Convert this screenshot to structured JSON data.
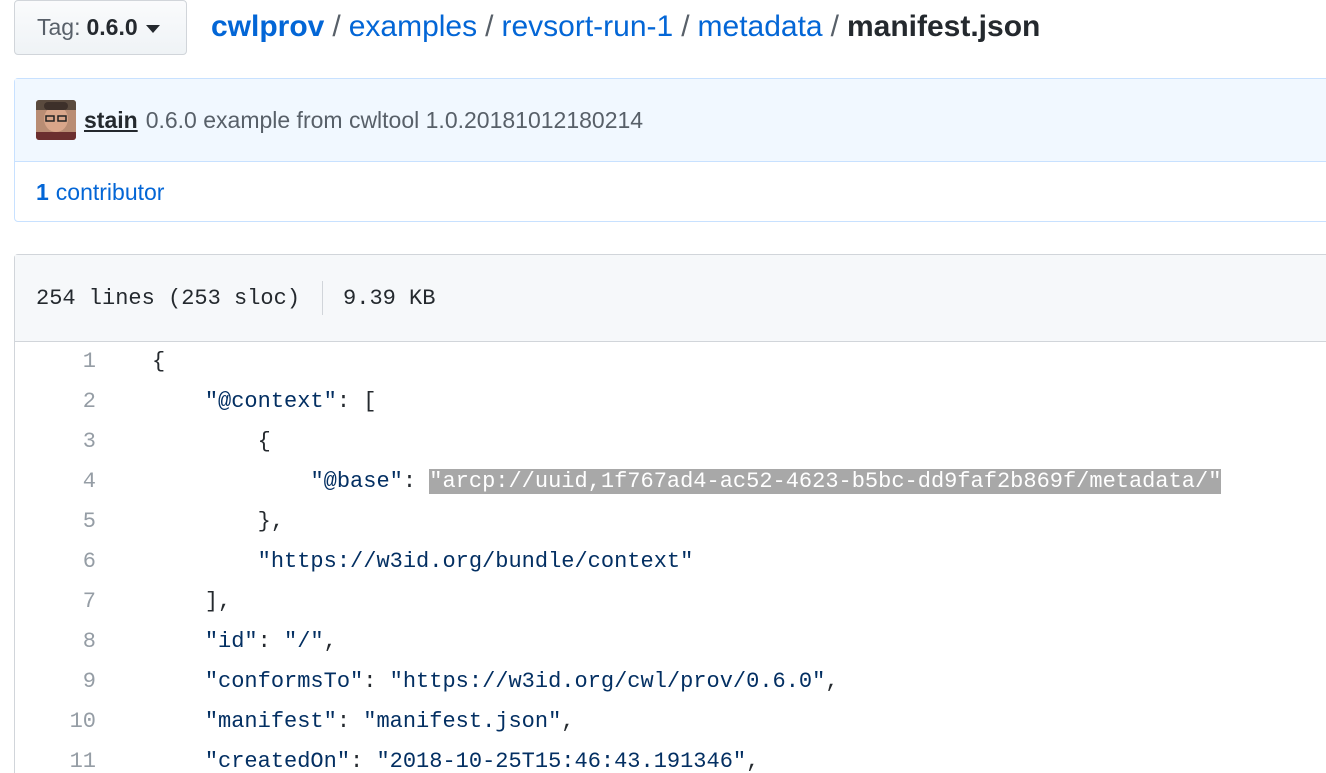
{
  "tag_selector": {
    "label": "Tag:",
    "value": "0.6.0"
  },
  "breadcrumb": {
    "repo": "cwlprov",
    "items": [
      "examples",
      "revsort-run-1",
      "metadata"
    ],
    "separator": "/",
    "final": "manifest.json"
  },
  "commit": {
    "author": "stain",
    "message": "0.6.0 example from cwltool 1.0.20181012180214"
  },
  "contributors": {
    "count": "1",
    "label": "contributor"
  },
  "file_info": {
    "lines": "254 lines (253 sloc)",
    "size": "9.39 KB"
  },
  "code_lines": [
    {
      "num": "1",
      "indent": "",
      "parts": [
        {
          "t": "{",
          "c": "p"
        }
      ]
    },
    {
      "num": "2",
      "indent": "    ",
      "parts": [
        {
          "t": "\"@context\"",
          "c": "s"
        },
        {
          "t": ": [",
          "c": "p"
        }
      ]
    },
    {
      "num": "3",
      "indent": "        ",
      "parts": [
        {
          "t": "{",
          "c": "p"
        }
      ]
    },
    {
      "num": "4",
      "indent": "            ",
      "parts": [
        {
          "t": "\"@base\"",
          "c": "s"
        },
        {
          "t": ": ",
          "c": "p"
        },
        {
          "t": "\"arcp://uuid,1f767ad4-ac52-4623-b5bc-dd9faf2b869f/metadata/\"",
          "c": "h"
        }
      ]
    },
    {
      "num": "5",
      "indent": "        ",
      "parts": [
        {
          "t": "},",
          "c": "p"
        }
      ]
    },
    {
      "num": "6",
      "indent": "        ",
      "parts": [
        {
          "t": "\"https://w3id.org/bundle/context\"",
          "c": "s"
        }
      ]
    },
    {
      "num": "7",
      "indent": "    ",
      "parts": [
        {
          "t": "],",
          "c": "p"
        }
      ]
    },
    {
      "num": "8",
      "indent": "    ",
      "parts": [
        {
          "t": "\"id\"",
          "c": "s"
        },
        {
          "t": ": ",
          "c": "p"
        },
        {
          "t": "\"/\"",
          "c": "s"
        },
        {
          "t": ",",
          "c": "p"
        }
      ]
    },
    {
      "num": "9",
      "indent": "    ",
      "parts": [
        {
          "t": "\"conformsTo\"",
          "c": "s"
        },
        {
          "t": ": ",
          "c": "p"
        },
        {
          "t": "\"https://w3id.org/cwl/prov/0.6.0\"",
          "c": "s"
        },
        {
          "t": ",",
          "c": "p"
        }
      ]
    },
    {
      "num": "10",
      "indent": "    ",
      "parts": [
        {
          "t": "\"manifest\"",
          "c": "s"
        },
        {
          "t": ": ",
          "c": "p"
        },
        {
          "t": "\"manifest.json\"",
          "c": "s"
        },
        {
          "t": ",",
          "c": "p"
        }
      ]
    },
    {
      "num": "11",
      "indent": "    ",
      "parts": [
        {
          "t": "\"createdOn\"",
          "c": "s"
        },
        {
          "t": ": ",
          "c": "p"
        },
        {
          "t": "\"2018-10-25T15:46:43.191346\"",
          "c": "s"
        },
        {
          "t": ",",
          "c": "p"
        }
      ]
    }
  ],
  "colors": {
    "link": "#0366d6",
    "string": "#032f62",
    "line_number": "#959da5",
    "highlight": "#a8a8a8",
    "commit_bg": "#f1f8ff"
  }
}
